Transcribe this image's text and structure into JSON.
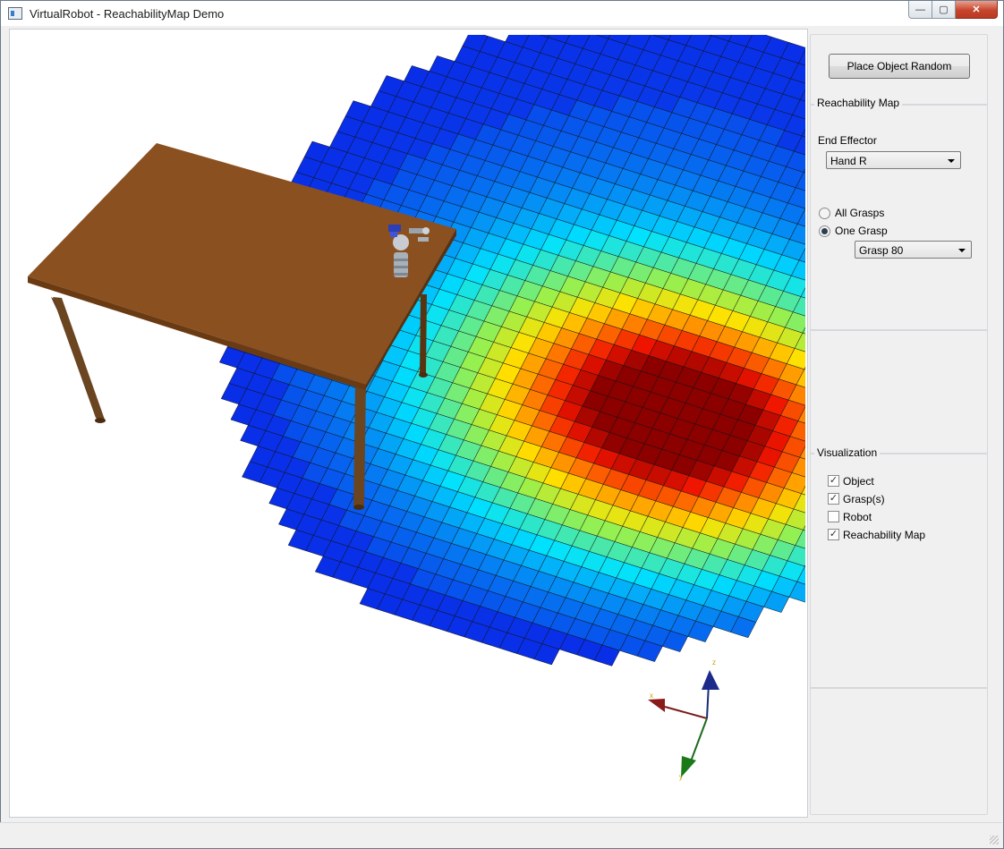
{
  "window": {
    "title": "VirtualRobot - ReachabilityMap Demo",
    "controls": {
      "minimize_icon": "minimize-icon",
      "maximize_icon": "maximize-icon",
      "close_icon": "close-icon"
    }
  },
  "viewport": {
    "axes": {
      "z_label": "z",
      "y_label": "y",
      "x_label": "x"
    }
  },
  "panel": {
    "place_button": "Place Object Random",
    "reachability_group": {
      "title": "Reachability Map",
      "end_effector_label": "End Effector",
      "end_effector_value": "Hand R",
      "all_grasps_label": "All Grasps",
      "one_grasp_label": "One Grasp",
      "grasp_mode": "One Grasp",
      "grasp_value": "Grasp 80"
    },
    "visualization_group": {
      "title": "Visualization",
      "object_label": "Object",
      "object_checked": true,
      "grasps_label": "Grasp(s)",
      "grasps_checked": true,
      "robot_label": "Robot",
      "robot_checked": false,
      "reachability_label": "Reachability Map",
      "reachability_checked": true
    }
  },
  "colors": {
    "table": "#8b5020",
    "heat_low": "#0a1ee6",
    "heat_high": "#8b0000"
  }
}
